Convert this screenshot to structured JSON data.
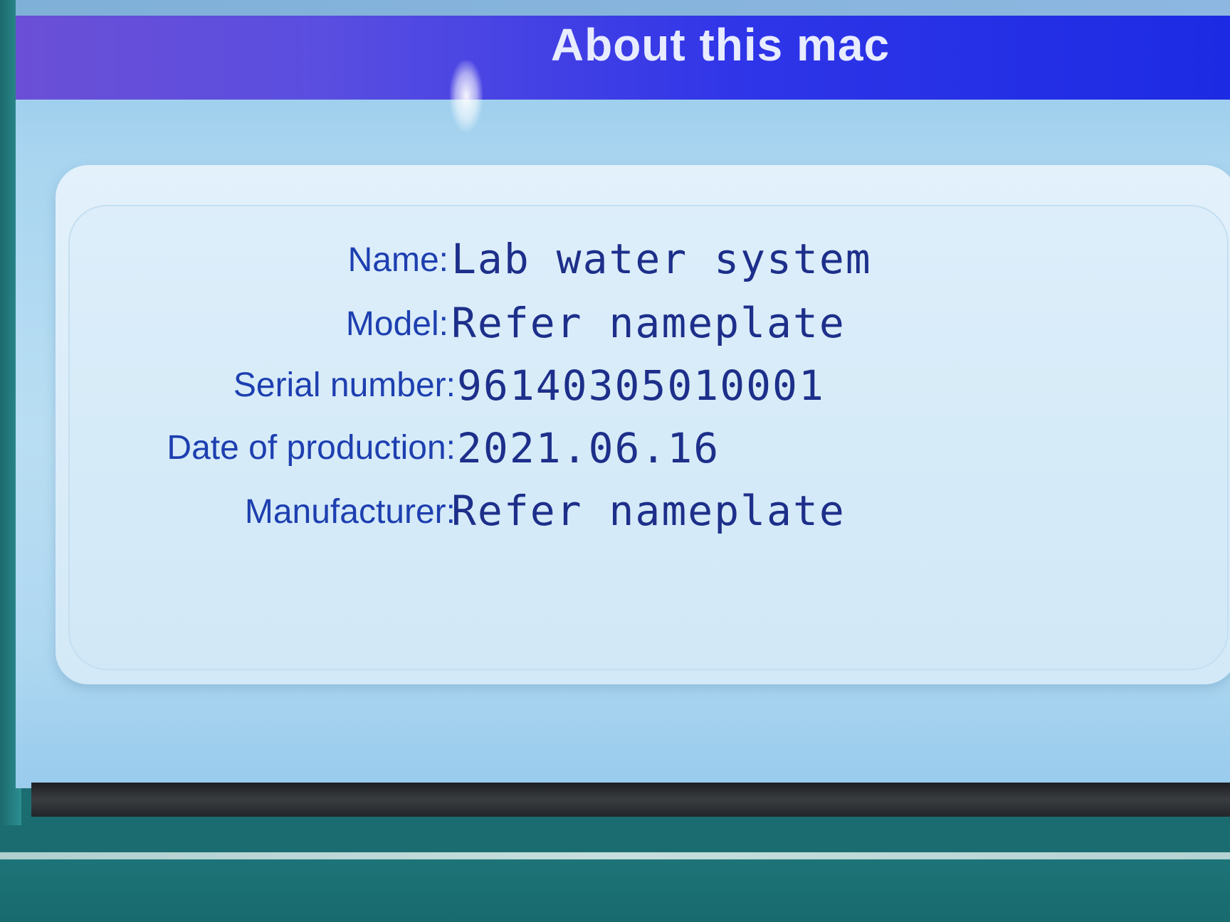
{
  "window": {
    "title": "About this mac"
  },
  "info": {
    "rows": [
      {
        "label": "Name:",
        "value": "Lab water system"
      },
      {
        "label": "Model:",
        "value": "Refer nameplate"
      },
      {
        "label": "Serial number:",
        "value": "96140305010001"
      },
      {
        "label": "Date of production:",
        "value": "2021.06.16"
      },
      {
        "label": "Manufacturer:",
        "value": "Refer nameplate"
      }
    ]
  },
  "colors": {
    "title_bar_start": "#6b4fd6",
    "title_bar_end": "#1c2be3",
    "label_text": "#1d3fb0",
    "value_text": "#1d2f8a",
    "screen_background": "#b9def3",
    "device_bezel": "#1e7376"
  }
}
